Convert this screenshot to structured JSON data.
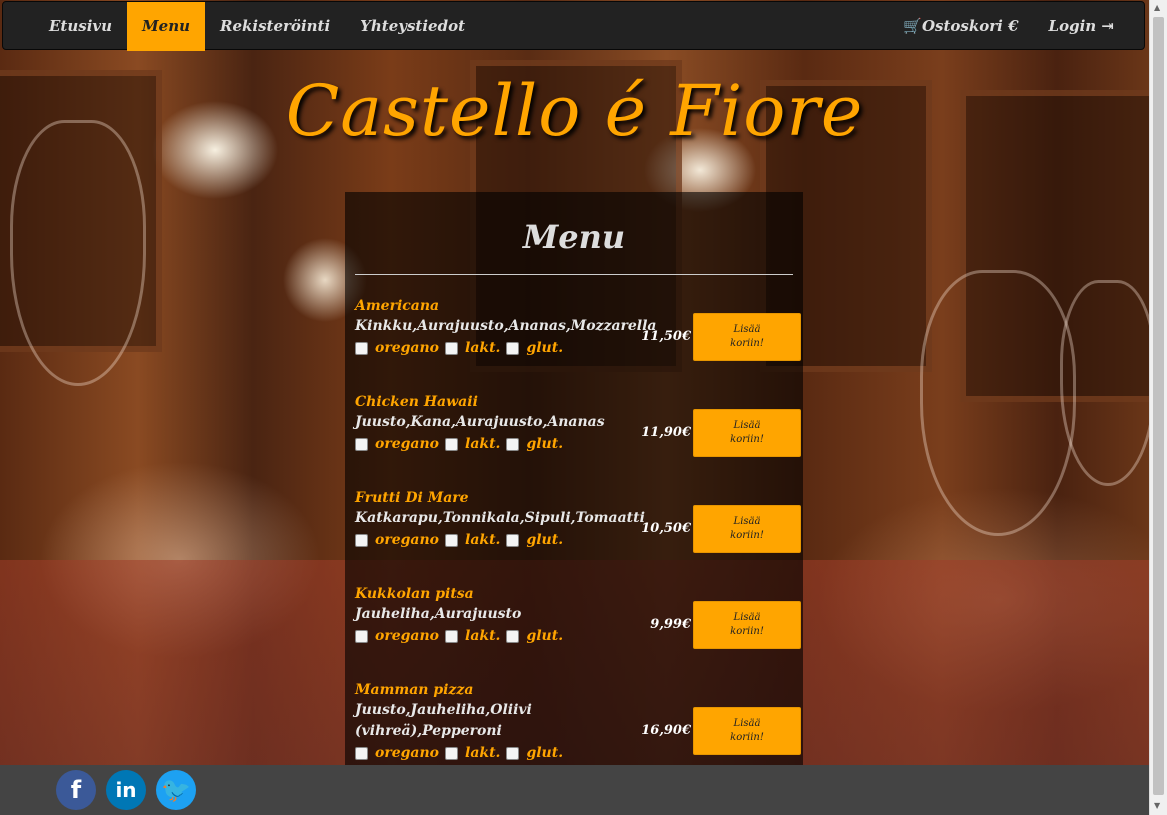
{
  "nav": {
    "left": [
      {
        "label": "Etusivu",
        "active": false
      },
      {
        "label": "Menu",
        "active": true
      },
      {
        "label": "Rekisteröinti",
        "active": false
      },
      {
        "label": "Yhteystiedot",
        "active": false
      }
    ],
    "cart_label": "Ostoskori €",
    "login_label": "Login",
    "cart_icon": "cart-icon",
    "login_icon": "sign-in-icon"
  },
  "brand": "Castello é Fiore",
  "menu": {
    "title": "Menu",
    "option_labels": [
      "oregano",
      "lakt.",
      "glut."
    ],
    "add_label": "Lisää koriin!",
    "items": [
      {
        "name": "Americana",
        "ingredients": "Kinkku,Aurajuusto,Ananas,Mozzarella",
        "price": "11,50€"
      },
      {
        "name": "Chicken Hawaii",
        "ingredients": "Juusto,Kana,Aurajuusto,Ananas",
        "price": "11,90€"
      },
      {
        "name": "Frutti Di Mare",
        "ingredients": "Katkarapu,Tonnikala,Sipuli,Tomaatti",
        "price": "10,50€"
      },
      {
        "name": "Kukkolan pitsa",
        "ingredients": "Jauheliha,Aurajuusto",
        "price": "9,99€"
      },
      {
        "name": "Mamman pizza",
        "ingredients": "Juusto,Jauheliha,Oliivi (vihreä),Pepperoni",
        "price": "16,90€"
      }
    ]
  },
  "social": [
    {
      "name": "facebook-icon",
      "glyph": "f",
      "color": "#3b5998"
    },
    {
      "name": "linkedin-icon",
      "glyph": "in",
      "color": "#0077b5"
    },
    {
      "name": "twitter-icon",
      "glyph": "🐦",
      "color": "#1da1f2"
    }
  ],
  "colors": {
    "accent": "#ffa500",
    "navbar": "#222222",
    "footer": "#444444"
  }
}
